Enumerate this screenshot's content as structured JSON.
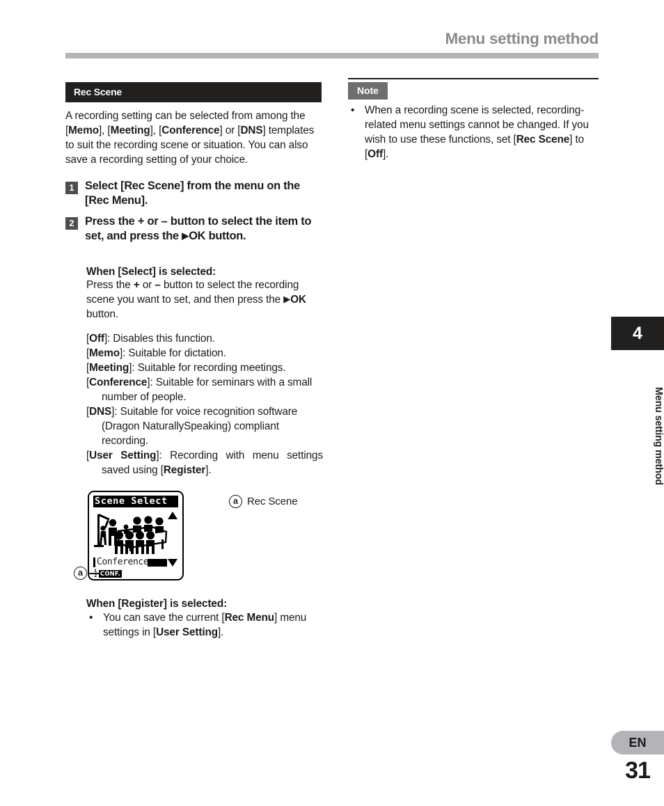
{
  "header": {
    "title": "Menu setting method"
  },
  "left_column": {
    "section_title": "Rec Scene",
    "intro": {
      "line1_a": "A recording setting can be selected",
      "line2_a": "from among the [",
      "memo": "Memo",
      "line2_b": "], [",
      "meeting": "Meeting",
      "line2_c": "],",
      "line3_a": "[",
      "conference": "Conference",
      "line3_b": "] or [",
      "dns": "DNS",
      "line3_c": "] templates to suit the",
      "line4": "recording scene or situation. You can also",
      "line5": "save a recording setting of your choice."
    },
    "steps": [
      {
        "number": "1",
        "pre": "Select [",
        "bold1": "Rec Scene",
        "mid": "] from the menu on the [",
        "bold2": "Rec Menu",
        "post": "]."
      },
      {
        "number": "2",
        "pre": "Press the + or – button to select the item to set, and press the ",
        "triangle": "▶",
        "bold1": "OK",
        "post": " button."
      }
    ],
    "select_block": {
      "heading_pre": "When [",
      "heading_bold": "Select",
      "heading_post": "] is selected:",
      "body_line1": "Press the ",
      "body_plus": "+",
      "body_or": " or ",
      "body_minus": "–",
      "body_line1b": " button to select the",
      "body_line2": "recording scene you want to set, and",
      "body_line3a": "then press the ",
      "body_triangle": "▶",
      "body_ok": "OK",
      "body_line3b": " button.",
      "definitions": [
        {
          "term": "Off",
          "desc": "]: Disables this function."
        },
        {
          "term": "Memo",
          "desc": "]: Suitable for dictation."
        },
        {
          "term": "Meeting",
          "desc": "]: Suitable for recording meetings."
        },
        {
          "term": "Conference",
          "desc": "]: Suitable for seminars with a small number of people."
        },
        {
          "term": "DNS",
          "desc": "]: Suitable for voice recognition software (Dragon NaturallySpeaking) compliant recording."
        },
        {
          "term": "User Setting",
          "desc_pre": "]: Recording with menu settings saved using [",
          "desc_bold": "Register",
          "desc_post": "]."
        }
      ]
    },
    "figure": {
      "lcd_title": "Scene Select",
      "lcd_selected": "Conference",
      "lcd_fraction_top": "1",
      "lcd_fraction_bottom": "2",
      "lcd_status_badge": "CONF.",
      "arrow_up": "up-triangle",
      "arrow_down": "down-triangle",
      "callout_marker": "a",
      "legend_marker": "a",
      "legend_label": "Rec Scene"
    },
    "register_block": {
      "heading_pre": "When [",
      "heading_bold": "Register",
      "heading_post": "] is selected:",
      "bullet_symbol": "•",
      "bullet_pre": "You can save the current [",
      "bullet_bold1": "Rec Menu",
      "bullet_mid": "] menu settings in [",
      "bullet_bold2": "User Setting",
      "bullet_post": "]."
    }
  },
  "right_column": {
    "note_tag": "Note",
    "note_bullet_symbol": "•",
    "note_pre": "When a recording scene is selected, recording-related menu settings cannot be changed. If you wish to use these functions, set [",
    "note_bold1": "Rec Scene",
    "note_mid": "] to [",
    "note_bold2": "Off",
    "note_post": "]."
  },
  "chapter_tab": {
    "number": "4",
    "label": "Menu setting method"
  },
  "footer": {
    "language": "EN",
    "page_number": "31"
  },
  "colors": {
    "section_bar": "#221f1f",
    "note_tag": "#6e6e70",
    "step_badge": "#4d4d4f",
    "header_gray": "#8a8a8d",
    "rule_gray": "#b4b4b8"
  }
}
